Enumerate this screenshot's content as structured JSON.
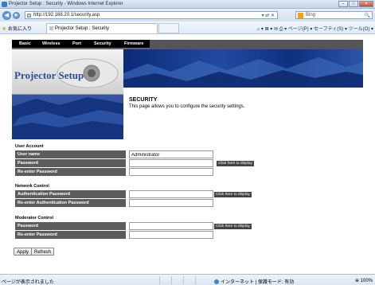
{
  "window": {
    "title": "Projector Setup : Security - Windows Internet Explorer",
    "buttons": {
      "minimize": "‒",
      "maximize": "□",
      "close": "✕"
    }
  },
  "address_bar": {
    "url": "http://192.168.20.1/security.asp",
    "tools": "▾ ⇄ ✕",
    "search_placeholder": "Bing",
    "search_icon": "🔍"
  },
  "command_bar": {
    "favorites_label": "お気に入り",
    "tab_title": "Projector Setup : Security",
    "commands": "⌂ ▾  ⊠ ▾  ✉  ⎙ ▾  ページ(P) ▾  セーフティ(S) ▾  ツール(O) ▾"
  },
  "nav": {
    "items": [
      "Basic",
      "Wireless",
      "Port",
      "Security",
      "Firmware"
    ]
  },
  "banner": {
    "logo_text": "Projector Setup"
  },
  "page": {
    "title": "SECURITY",
    "description": "This page allows you to configure the security settings."
  },
  "user_account": {
    "heading": "User Account",
    "username_label": "User name",
    "username_value": "Administrator",
    "password_label": "Password",
    "reenter_label": "Re-enter Password",
    "display_link": "Click here to display"
  },
  "network_control": {
    "heading": "Network Control",
    "auth_label": "Authentication Password",
    "reauth_label": "Re-enter Authentication Password",
    "display_link": "Click here to display"
  },
  "moderator_control": {
    "heading": "Moderator Control",
    "password_label": "Password",
    "reenter_label": "Re-enter Password",
    "display_link": "Click here to display"
  },
  "buttons": {
    "apply": "Apply",
    "refresh": "Refresh"
  },
  "status_bar": {
    "text": "ページが表示されました",
    "zone": "インターネット | 保護モード: 有効",
    "zoom": "⊕ 100%"
  },
  "colors": {
    "label_bg": "#5c5c5c",
    "nav_bg": "#000000",
    "banner_blue": "#1e3f8f"
  }
}
